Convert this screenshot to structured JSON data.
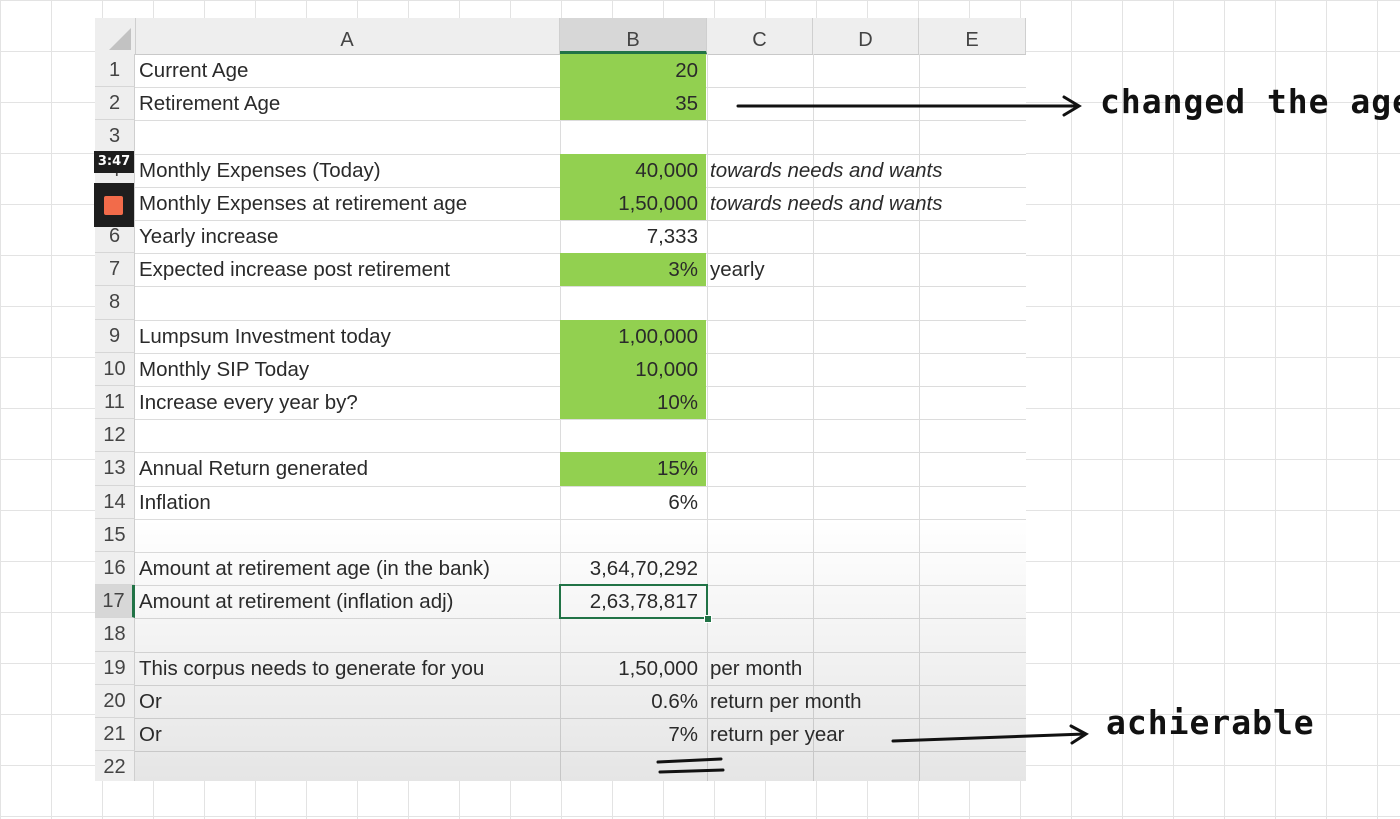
{
  "columns": [
    "A",
    "B",
    "C",
    "D",
    "E"
  ],
  "rows": [
    {
      "n": "1",
      "label": "Current Age",
      "value": "20",
      "note": "",
      "green": true,
      "italic": false
    },
    {
      "n": "2",
      "label": "Retirement Age",
      "value": "35",
      "note": "",
      "green": true,
      "italic": false
    },
    {
      "n": "3",
      "label": "",
      "value": "",
      "note": "",
      "green": false,
      "italic": false
    },
    {
      "n": "4",
      "label": "Monthly Expenses (Today)",
      "value": "40,000",
      "note": "towards needs and wants",
      "green": true,
      "italic": true
    },
    {
      "n": "5",
      "label": "Monthly Expenses at retirement age",
      "value": "1,50,000",
      "note": "towards needs and wants",
      "green": true,
      "italic": true
    },
    {
      "n": "6",
      "label": "Yearly increase",
      "value": "7,333",
      "note": "",
      "green": false,
      "italic": false
    },
    {
      "n": "7",
      "label": "Expected increase post retirement",
      "value": "3%",
      "note": "yearly",
      "green": true,
      "italic": false
    },
    {
      "n": "8",
      "label": "",
      "value": "",
      "note": "",
      "green": false,
      "italic": false
    },
    {
      "n": "9",
      "label": "Lumpsum Investment today",
      "value": "1,00,000",
      "note": "",
      "green": true,
      "italic": false
    },
    {
      "n": "10",
      "label": "Monthly SIP Today",
      "value": "10,000",
      "note": "",
      "green": true,
      "italic": false
    },
    {
      "n": "11",
      "label": "Increase every year by?",
      "value": "10%",
      "note": "",
      "green": true,
      "italic": false
    },
    {
      "n": "12",
      "label": "",
      "value": "",
      "note": "",
      "green": false,
      "italic": false
    },
    {
      "n": "13",
      "label": "Annual Return generated",
      "value": "15%",
      "note": "",
      "green": true,
      "italic": false
    },
    {
      "n": "14",
      "label": "Inflation",
      "value": "6%",
      "note": "",
      "green": false,
      "italic": false
    },
    {
      "n": "15",
      "label": "",
      "value": "",
      "note": "",
      "green": false,
      "italic": false
    },
    {
      "n": "16",
      "label": "Amount at retirement age (in the bank)",
      "value": "3,64,70,292",
      "note": "",
      "green": false,
      "italic": false
    },
    {
      "n": "17",
      "label": "Amount at retirement (inflation adj)",
      "value": "2,63,78,817",
      "note": "",
      "green": false,
      "italic": false
    },
    {
      "n": "18",
      "label": "",
      "value": "",
      "note": "",
      "green": false,
      "italic": false
    },
    {
      "n": "19",
      "label": "This corpus needs to generate for you",
      "value": "1,50,000",
      "note": "per month",
      "green": false,
      "italic": false
    },
    {
      "n": "20",
      "label": "Or",
      "value": "0.6%",
      "note": "return per month",
      "green": false,
      "italic": false
    },
    {
      "n": "21",
      "label": "Or",
      "value": "7%",
      "note": "return per year",
      "green": false,
      "italic": false
    },
    {
      "n": "22",
      "label": "",
      "value": "",
      "note": "",
      "green": false,
      "italic": false
    }
  ],
  "selected_column": "B",
  "selected_row": "17",
  "colors": {
    "input_fill": "#92d050",
    "selection": "#217346"
  },
  "overlay": {
    "timer": "3:47",
    "record_icon": "stop-record-icon"
  },
  "annotations": {
    "changed_age": "changed the age",
    "achievable": "achierable"
  }
}
